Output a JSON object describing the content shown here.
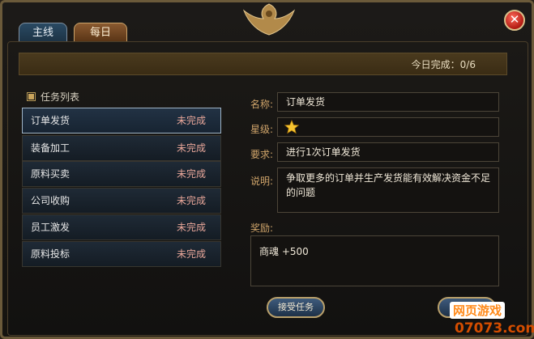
{
  "tabs": [
    {
      "label": "主线"
    },
    {
      "label": "每日"
    }
  ],
  "close_icon": "close-icon",
  "progress": {
    "text": "今日完成：0/6"
  },
  "task_list": {
    "header": "任务列表",
    "items": [
      {
        "name": "订单发货",
        "status": "未完成"
      },
      {
        "name": "装备加工",
        "status": "未完成"
      },
      {
        "name": "原料买卖",
        "status": "未完成"
      },
      {
        "name": "公司收购",
        "status": "未完成"
      },
      {
        "name": "员工激发",
        "status": "未完成"
      },
      {
        "name": "原料投标",
        "status": "未完成"
      }
    ]
  },
  "details": {
    "name_label": "名称:",
    "name_value": "订单发货",
    "stars_label": "星级:",
    "stars": 1,
    "requirement_label": "要求:",
    "requirement_value": "进行1次订单发货",
    "desc_label": "说明:",
    "desc_value": "争取更多的订单并生产发货能有效解决资金不足的问题",
    "reward_label": "奖励:",
    "reward_value": "商魂 +500"
  },
  "accept_button": "接受任务",
  "watermark": {
    "top": "网页游戏",
    "bottom": "07073.com"
  },
  "colors": {
    "status": "#e9a79a",
    "label": "#cfa46a",
    "accent": "#ff8a1a"
  }
}
